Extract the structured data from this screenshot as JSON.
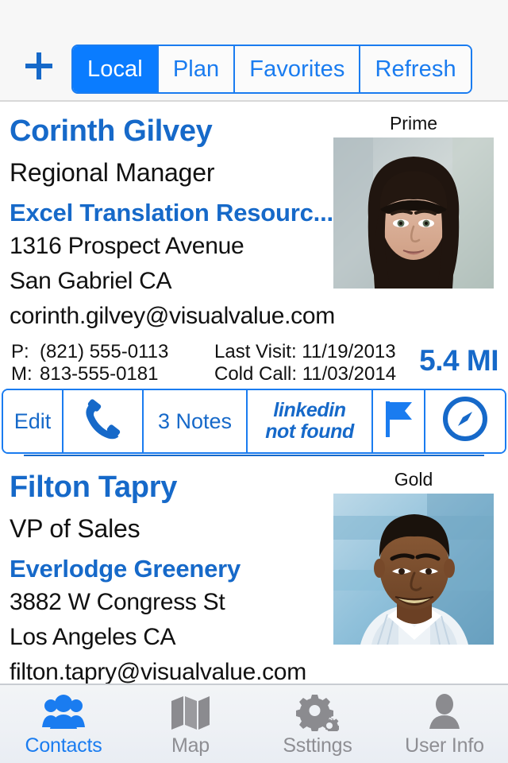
{
  "header": {
    "add_label": "+",
    "segments": [
      {
        "label": "Local",
        "active": true
      },
      {
        "label": "Plan",
        "active": false
      },
      {
        "label": "Favorites",
        "active": false
      },
      {
        "label": "Refresh",
        "active": false
      }
    ]
  },
  "colors": {
    "accent_blue": "#1669c9",
    "segment_blue": "#0a7cff",
    "border_blue": "#1a7cf0",
    "text_black": "#111111",
    "tab_gray": "#8e8e93",
    "header_bg": "#f7f7f7"
  },
  "contacts": [
    {
      "name": "Corinth Gilvey",
      "title": "Regional Manager",
      "company": "Excel Translation Resourc...",
      "address_line1": "1316 Prospect Avenue",
      "address_line2": "San Gabriel  CA",
      "email": "corinth.gilvey@visualvalue.com",
      "tier": "Prime",
      "phone_label": "P:",
      "phone_value": "(821) 555-0113",
      "mobile_label": "M:",
      "mobile_value": "813-555-0181",
      "last_visit": "Last Visit: 11/19/2013",
      "cold_call": "Cold Call: 11/03/2014",
      "distance": "5.4 MI",
      "actions": {
        "edit_label": "Edit",
        "phone_icon": "phone-icon",
        "notes_label": "3 Notes",
        "linkedin_line1": "linkedin",
        "linkedin_line2": "not found",
        "flag_icon": "flag-icon",
        "map_icon": "compass-icon"
      }
    },
    {
      "name": "Filton Tapry",
      "title": "VP of Sales",
      "company": "Everlodge Greenery",
      "address_line1": "3882 W Congress St",
      "address_line2": "Los Angeles  CA",
      "email": "filton.tapry@visualvalue.com",
      "tier": "Gold"
    }
  ],
  "tabs": [
    {
      "label": "Contacts",
      "icon": "contacts-icon",
      "active": true
    },
    {
      "label": "Map",
      "icon": "map-icon",
      "active": false
    },
    {
      "label": "Ssttings",
      "icon": "gear-icon",
      "active": false
    },
    {
      "label": "User Info",
      "icon": "user-icon",
      "active": false
    }
  ]
}
